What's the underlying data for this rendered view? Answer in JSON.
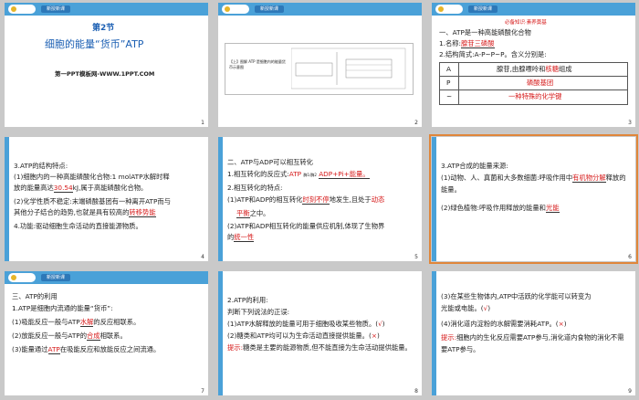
{
  "tab_label": "新授新课",
  "s1": {
    "section": "第2节",
    "title": "细胞的能量“货币”ATP",
    "footer": "第一PPT模板网-WWW.1PPT.COM",
    "num": "1"
  },
  "s2": {
    "box_text": "【上】图解 ATP 是细胞内的能量货币示意图",
    "num": "2"
  },
  "s3": {
    "banner": "必备知识·素养奠基",
    "h1": "一、ATP是一种高能磷酸化合物",
    "name_label": "1.名称:",
    "name_ans": "腺苷三磷酸",
    "formula": "2.结构简式:A-P~P~P。含义分别是:",
    "row_a": "A",
    "row_p": "P",
    "row_t": "~",
    "a_text": "腺苷,由腺嘌呤和",
    "a_ans": "核糖",
    "a_tail": "组成",
    "p_ans": "磷酸基团",
    "t_ans": "一种特殊的化学键",
    "num": "3"
  },
  "s4": {
    "h": "3.ATP的结构特点:",
    "l1": "(1)细胞内的一种高能磷酸化合物:1 molATP水解时释",
    "l2a": "放的能量高达",
    "l2ans": "30.54",
    "l2b": "kJ,属于高能磷酸化合物。",
    "l3": "(2)化学性质不稳定:末端磷酸基团有一种离开ATP而与",
    "l4a": "其他分子结合的趋势,也就是具有较高的",
    "l4ans": "转移势能",
    "l5": "4.功能:驱动细胞生命活动的直接能源物质。",
    "num": "4"
  },
  "s5": {
    "h": "二、ATP与ADP可以相互转化",
    "l1a": "1.相互转化的反应式:",
    "l1ans": "ATP",
    "l1mid": "酶1/酶2",
    "l1ans2": "ADP+Pi+能量。",
    "l2": "2.相互转化的特点:",
    "l3a": "(1)ATP和ADP的相互转化",
    "l3ans": "时刻不停",
    "l3b": "地发生,且处于",
    "l3ans2": "动态",
    "l4ans": "平衡",
    "l4b": "之中。",
    "l5": "(2)ATP和ADP相互转化的能量供应机制,体现了生物界",
    "l6a": "的",
    "l6ans": "统一性",
    "num": "5"
  },
  "s6": {
    "h": "3.ATP合成的能量来源:",
    "l1a": "(1)动物、人、真菌和大多数细菌:呼吸作用中",
    "l1ans": "有机物分解",
    "l2": "释放的能量。",
    "l3a": "(2)绿色植物:呼吸作用释放的能量和",
    "l3ans": "光能",
    "num": "6"
  },
  "s7": {
    "h": "三、ATP的利用",
    "l1": "1.ATP是细胞内流通的能量“货币”:",
    "l2a": "(1)吸能反应一般与ATP",
    "l2ans": "水解",
    "l2b": "的反应相联系。",
    "l3a": "(2)放能反应一般与ATP的",
    "l3ans": "合成",
    "l3b": "相联系。",
    "l4a": "(3)能量通过",
    "l4ans": "ATP",
    "l4b": "在吸能反应和放能反应之间流通。",
    "num": "7"
  },
  "s8": {
    "l1": "2.ATP的利用:",
    "l2": "判断下列说法的正误:",
    "l3a": "(1)ATP水解释放的能量可用于细胞吸收某些物质。",
    "l3ans": "√",
    "l4a": "(2)糖类和ATP均可以为生命活动直接提供能量。",
    "l4ans": "×",
    "tip_label": "提示:",
    "tip": "糖类是主要的能源物质,但不能直接为生命活动提供能量。",
    "num": "8"
  },
  "s9": {
    "l1": "(3)在某些生物体内,ATP中活跃的化学能可以转变为",
    "l2": "光能或电能。",
    "l2ans": "√",
    "l3": "(4)消化道内淀粉的水解需要消耗ATP。",
    "l3ans": "×",
    "tip_label": "提示:",
    "tip": "细胞内的生化反应需要ATP参与,消化道内食物的消化不需要ATP参与。",
    "num": "9"
  }
}
